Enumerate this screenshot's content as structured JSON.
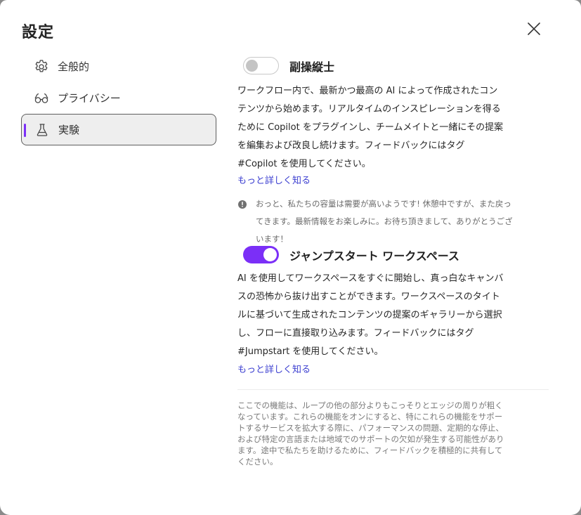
{
  "dialog": {
    "title": "設定",
    "close_label": "×"
  },
  "nav": {
    "items": [
      {
        "label": "全般的",
        "icon": "gear-icon"
      },
      {
        "label": "プライバシー",
        "icon": "glasses-icon"
      },
      {
        "label": "実験",
        "icon": "flask-icon"
      }
    ],
    "active_index": 2
  },
  "features": [
    {
      "title": "副操縦士",
      "enabled": false,
      "description": "ワークフロー内で、最新かつ最高の AI によって作成されたコンテンツから始めます。リアルタイムのインスピレーションを得るために Copilot をプラグインし、チームメイトと一緒にその提案を編集および改良し続けます。フィードバックにはタグ #Copilot を使用してください。",
      "link": "もっと詳しく知る",
      "notice": "おっと、私たちの容量は需要が高いようです! 休憩中ですが、また戻ってきます。最新情報をお楽しみに。お待ち頂きまして、ありがとうございます！"
    },
    {
      "title": "ジャンプスタート ワークスペース",
      "enabled": true,
      "description": "AI を使用してワークスペースをすぐに開始し、真っ白なキャンバスの恐怖から抜け出すことができます。ワークスペースのタイトルに基づいて生成されたコンテンツの提案のギャラリーから選択し、フローに直接取り込みます。フィードバックにはタグ #Jumpstart を使用してください。",
      "link": "もっと詳しく知る"
    }
  ],
  "footer": "ここでの機能は、ループの他の部分よりもこっそりとエッジの周りが粗くなっています。これらの機能をオンにすると、特にこれらの機能をサポートするサービスを拡大する際に、パフォーマンスの問題、定期的な停止、および特定の言語または地域でのサポートの欠如が発生する可能性があります。途中で私たちを助けるために、フィードバックを積極的に共有してください。",
  "colors": {
    "accent": "#7b2ff7",
    "link": "#3b3ed0"
  }
}
